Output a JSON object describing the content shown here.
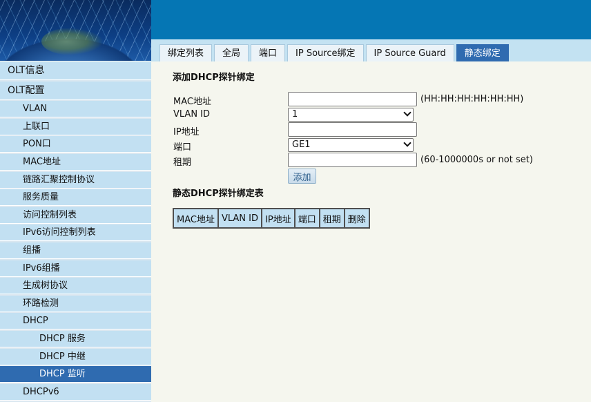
{
  "tabs": [
    {
      "label": "绑定列表",
      "active": false
    },
    {
      "label": "全局",
      "active": false
    },
    {
      "label": "端口",
      "active": false
    },
    {
      "label": "IP Source绑定",
      "active": false
    },
    {
      "label": "IP Source Guard",
      "active": false
    },
    {
      "label": "静态绑定",
      "active": true
    }
  ],
  "sidebar": {
    "items": [
      {
        "label": "OLT信息",
        "level": 0
      },
      {
        "label": "OLT配置",
        "level": 0
      },
      {
        "label": "VLAN",
        "level": 1
      },
      {
        "label": "上联口",
        "level": 1
      },
      {
        "label": "PON口",
        "level": 1
      },
      {
        "label": "MAC地址",
        "level": 1
      },
      {
        "label": "链路汇聚控制协议",
        "level": 1
      },
      {
        "label": "服务质量",
        "level": 1
      },
      {
        "label": "访问控制列表",
        "level": 1
      },
      {
        "label": "IPv6访问控制列表",
        "level": 1
      },
      {
        "label": "组播",
        "level": 1
      },
      {
        "label": "IPv6组播",
        "level": 1
      },
      {
        "label": "生成树协议",
        "level": 1
      },
      {
        "label": "环路检测",
        "level": 1
      },
      {
        "label": "DHCP",
        "level": 1
      },
      {
        "label": "DHCP 服务",
        "level": 2
      },
      {
        "label": "DHCP 中继",
        "level": 2
      },
      {
        "label": "DHCP 监听",
        "level": 2,
        "active": true
      },
      {
        "label": "DHCPv6",
        "level": 1
      }
    ]
  },
  "form": {
    "title": "添加DHCP探针绑定",
    "mac_label": "MAC地址",
    "mac_value": "",
    "mac_hint": "(HH:HH:HH:HH:HH:HH)",
    "vlan_label": "VLAN ID",
    "vlan_value": "1",
    "ip_label": "IP地址",
    "ip_value": "",
    "port_label": "端口",
    "port_value": "GE1",
    "lease_label": "租期",
    "lease_value": "",
    "lease_hint": "(60-1000000s or not set)",
    "add_label": "添加"
  },
  "table": {
    "title": "静态DHCP探针绑定表",
    "headers": [
      "MAC地址",
      "VLAN ID",
      "IP地址",
      "端口",
      "租期",
      "删除"
    ]
  },
  "colors": {
    "topbar": "#0576b4",
    "tab_active": "#2f6bb0",
    "nav_bg": "#c2e0f2",
    "page_bg": "#f5f6ee"
  }
}
